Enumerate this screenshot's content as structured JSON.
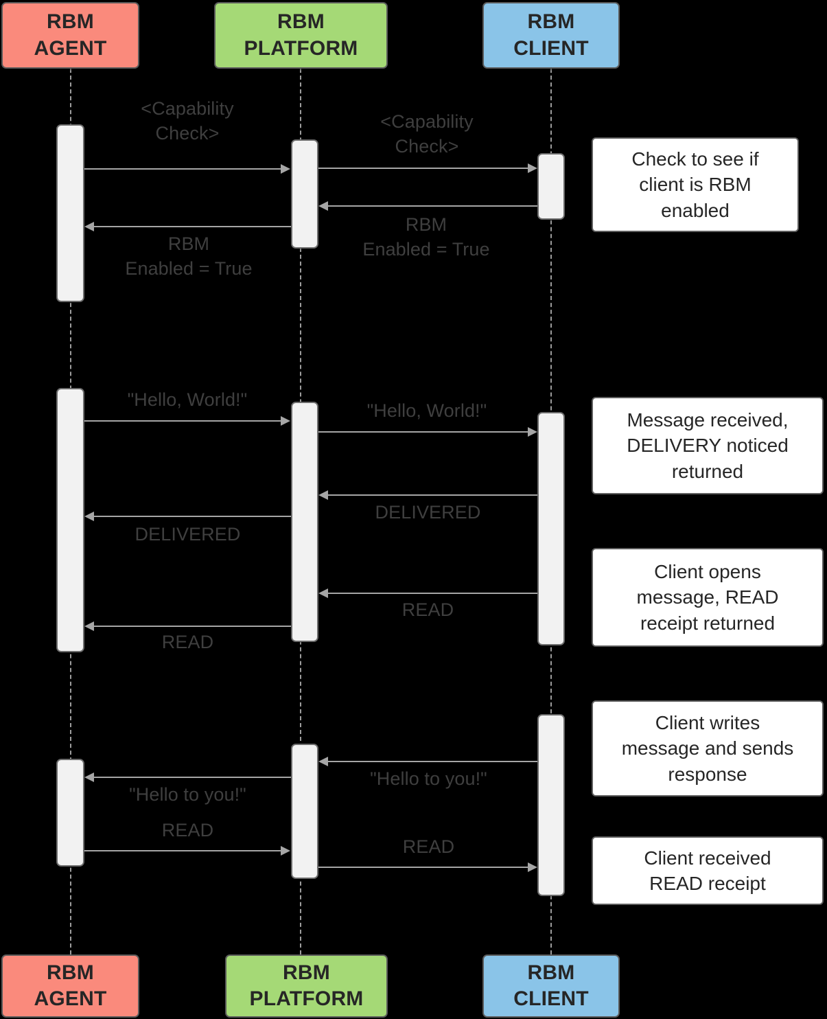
{
  "diagram": {
    "title": "RBM Message Flow Sequence Diagram",
    "background_color": "#000000",
    "message_text_color": "#3f3f3f",
    "line_color": "#a6a6a6"
  },
  "participants": [
    {
      "id": "agent",
      "line1": "RBM",
      "line2": "AGENT",
      "color": "#fa8a7c",
      "border_color": "#5a5a5a"
    },
    {
      "id": "platform",
      "line1": "RBM",
      "line2": "PLATFORM",
      "color": "#a5d976",
      "border_color": "#5a5a5a"
    },
    {
      "id": "client",
      "line1": "RBM",
      "line2": "CLIENT",
      "color": "#8ac4e8",
      "border_color": "#5a5a5a"
    }
  ],
  "messages": [
    {
      "id": "m1",
      "label": "<Capability\nCheck>",
      "from": "agent",
      "to": "platform",
      "direction": "right"
    },
    {
      "id": "m2",
      "label": "<Capability\nCheck>",
      "from": "platform",
      "to": "client",
      "direction": "right"
    },
    {
      "id": "m3",
      "label": "RBM\nEnabled = True",
      "from": "client",
      "to": "platform",
      "direction": "left"
    },
    {
      "id": "m4",
      "label": "RBM\nEnabled = True",
      "from": "platform",
      "to": "agent",
      "direction": "left"
    },
    {
      "id": "m5",
      "label": "\"Hello, World!\"",
      "from": "agent",
      "to": "platform",
      "direction": "right"
    },
    {
      "id": "m6",
      "label": "\"Hello, World!\"",
      "from": "platform",
      "to": "client",
      "direction": "right"
    },
    {
      "id": "m7",
      "label": "DELIVERED",
      "from": "client",
      "to": "platform",
      "direction": "left"
    },
    {
      "id": "m8",
      "label": "DELIVERED",
      "from": "platform",
      "to": "agent",
      "direction": "left"
    },
    {
      "id": "m9",
      "label": "READ",
      "from": "client",
      "to": "platform",
      "direction": "left"
    },
    {
      "id": "m10",
      "label": "READ",
      "from": "platform",
      "to": "agent",
      "direction": "left"
    },
    {
      "id": "m11",
      "label": "\"Hello to you!\"",
      "from": "client",
      "to": "platform",
      "direction": "left"
    },
    {
      "id": "m12",
      "label": "\"Hello to you!\"",
      "from": "platform",
      "to": "agent",
      "direction": "left"
    },
    {
      "id": "m13",
      "label": "READ",
      "from": "agent",
      "to": "platform",
      "direction": "right"
    },
    {
      "id": "m14",
      "label": "READ",
      "from": "platform",
      "to": "client",
      "direction": "right"
    }
  ],
  "notes": [
    {
      "id": "n1",
      "text": "Check to see if\nclient is RBM\nenabled"
    },
    {
      "id": "n2",
      "text": "Message received,\nDELIVERY noticed\nreturned"
    },
    {
      "id": "n3",
      "text": "Client opens\nmessage, READ\nreceipt returned"
    },
    {
      "id": "n4",
      "text": "Client writes\nmessage and sends\nresponse"
    },
    {
      "id": "n5",
      "text": "Client received\nREAD receipt"
    }
  ]
}
